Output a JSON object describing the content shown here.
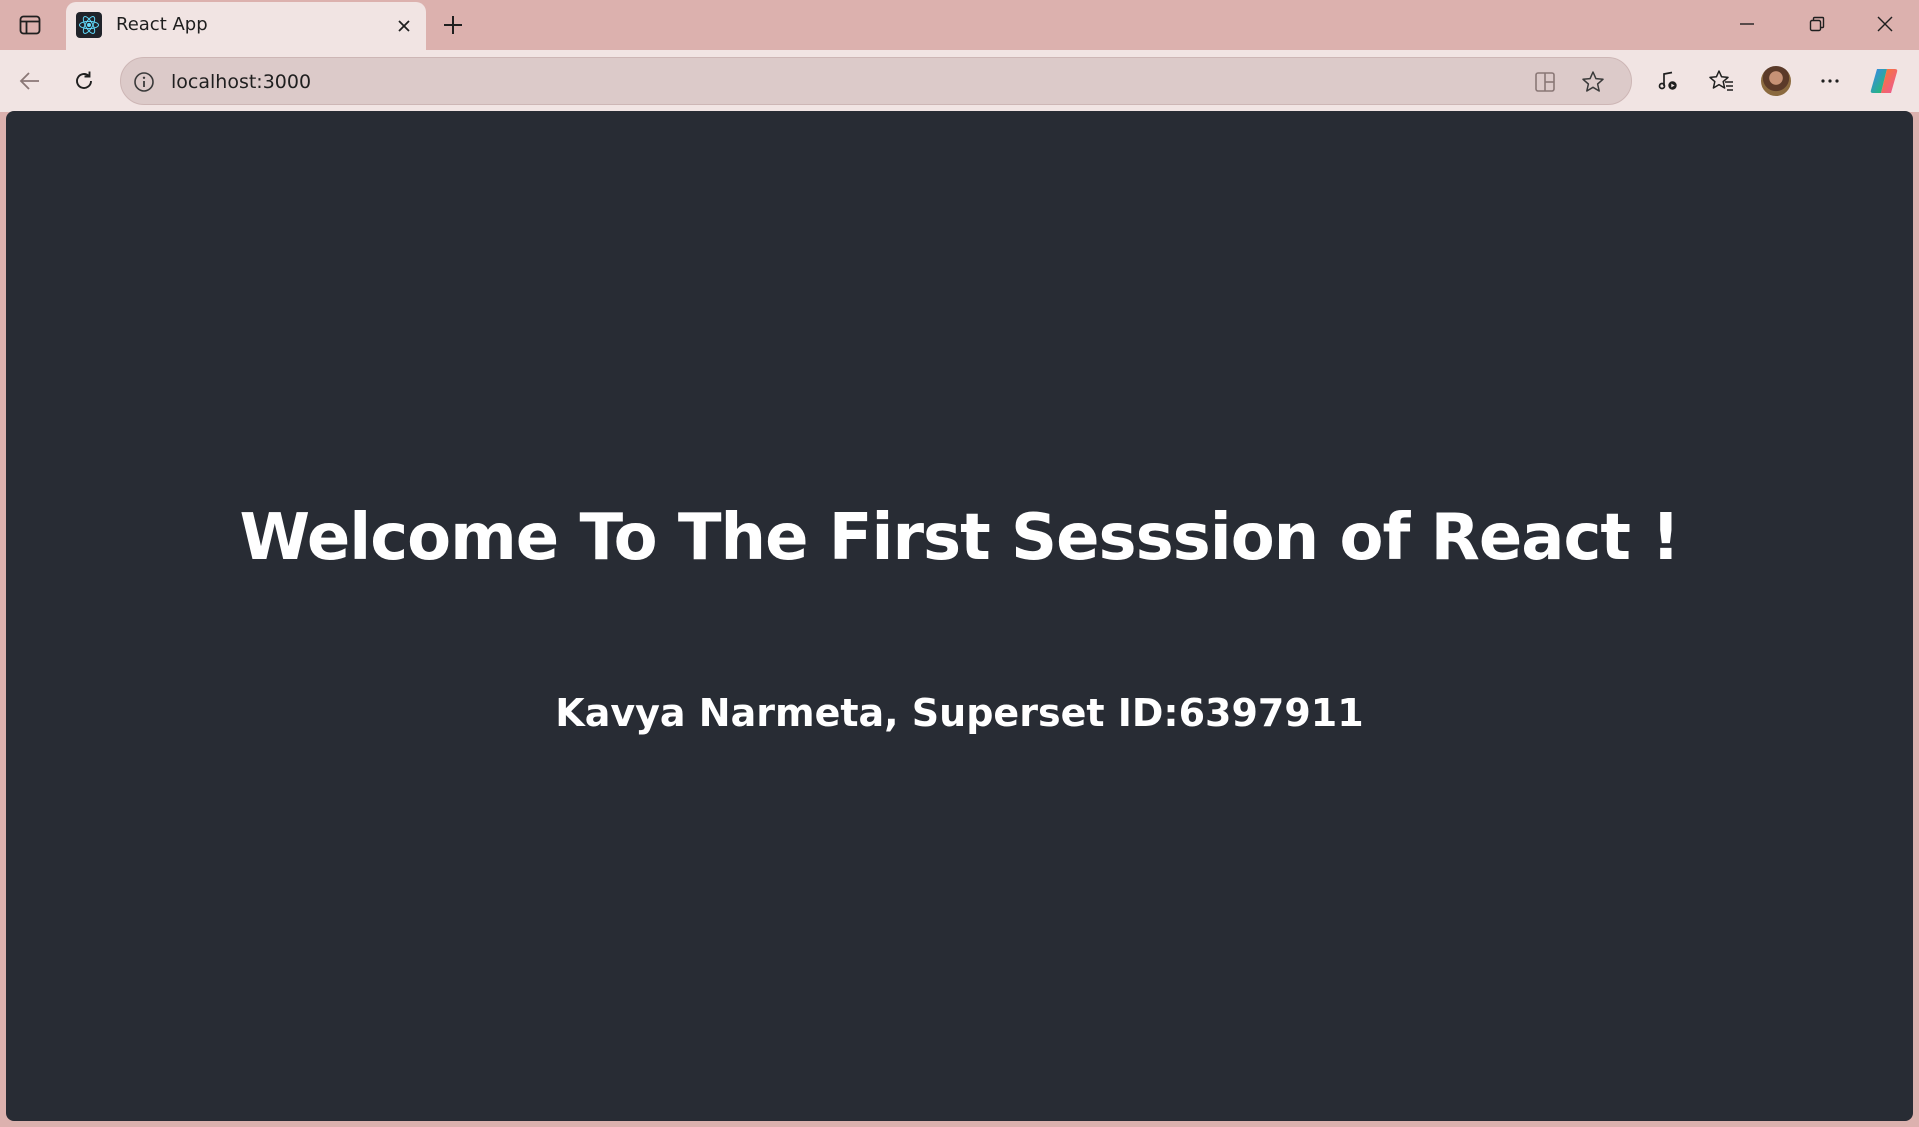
{
  "browser": {
    "tab": {
      "title": "React App",
      "favicon": "react-logo-icon"
    },
    "address_bar": {
      "url": "localhost:3000",
      "info_icon": "info-icon"
    },
    "toolbar_icons": [
      "back-arrow-icon",
      "reload-icon",
      "split-screen-icon",
      "favorite-star-icon",
      "media-control-icon",
      "favorites-icon",
      "profile-avatar",
      "more-icon",
      "copilot-icon"
    ],
    "window_controls": [
      "minimize-icon",
      "restore-icon",
      "close-icon"
    ]
  },
  "page": {
    "heading": "Welcome To The First Sesssion of React !",
    "subheading": "Kavya Narmeta, Superset ID:6397911",
    "background_color": "#282c34",
    "text_color": "#ffffff"
  },
  "colors": {
    "tabstrip": "#dcb1ae",
    "toolbar": "#f1e4e3",
    "react_accent": "#61dafb"
  }
}
